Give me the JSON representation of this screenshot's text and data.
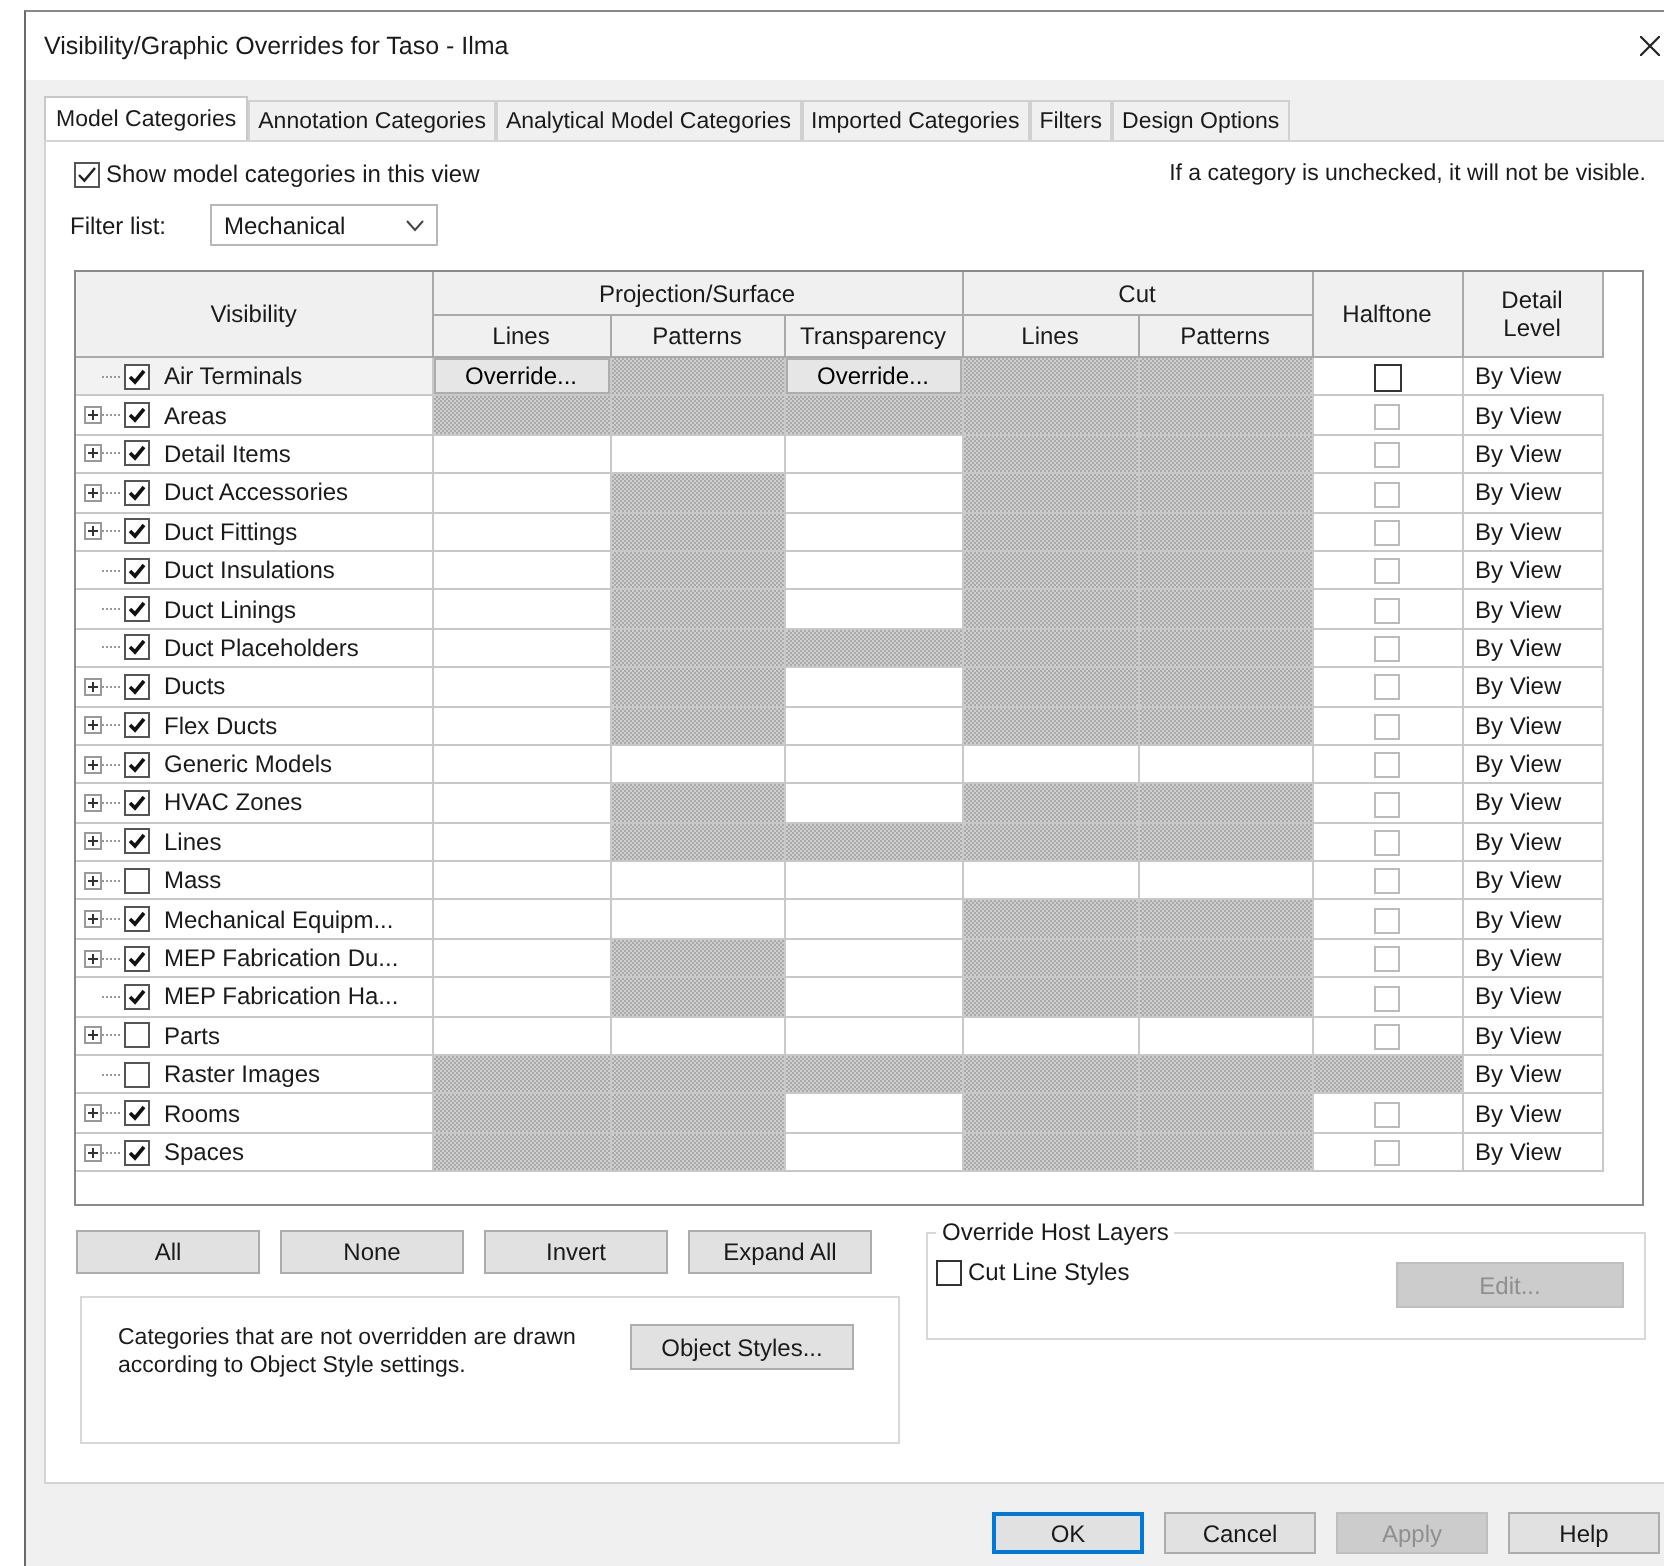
{
  "window": {
    "title": "Visibility/Graphic Overrides for Taso - Ilma"
  },
  "tabs": [
    {
      "label": "Model Categories",
      "selected": true
    },
    {
      "label": "Annotation Categories",
      "selected": false
    },
    {
      "label": "Analytical Model Categories",
      "selected": false
    },
    {
      "label": "Imported Categories",
      "selected": false
    },
    {
      "label": "Filters",
      "selected": false
    },
    {
      "label": "Design Options",
      "selected": false
    }
  ],
  "show_checkbox": {
    "label": "Show model categories in this view",
    "checked": true
  },
  "hint": "If a category is unchecked, it will not be visible.",
  "filter": {
    "label": "Filter list:",
    "value": "Mechanical"
  },
  "table": {
    "visibility": "Visibility",
    "groups": [
      {
        "label": "Projection/Surface",
        "columns": [
          "Lines",
          "Patterns",
          "Transparency"
        ]
      },
      {
        "label": "Cut",
        "columns": [
          "Lines",
          "Patterns"
        ]
      }
    ],
    "halftone": "Halftone",
    "detail_level": "Detail Level",
    "rows": [
      {
        "name": "Air Terminals",
        "checked": true,
        "expandable": false,
        "selected": true,
        "cells": [
          {
            "kind": "button",
            "label": "Override..."
          },
          {
            "kind": "hatched"
          },
          {
            "kind": "button",
            "label": "Override..."
          },
          {
            "kind": "hatched"
          },
          {
            "kind": "hatched"
          }
        ],
        "halftone": {
          "kind": "checkbox",
          "checked": false
        },
        "detail": "By View"
      },
      {
        "name": "Areas",
        "checked": true,
        "expandable": true,
        "selected": false,
        "cells": [
          {
            "kind": "hatched"
          },
          {
            "kind": "hatched"
          },
          {
            "kind": "hatched"
          },
          {
            "kind": "hatched"
          },
          {
            "kind": "hatched"
          }
        ],
        "halftone": {
          "kind": "checkbox",
          "checked": false
        },
        "detail": "By View"
      },
      {
        "name": "Detail Items",
        "checked": true,
        "expandable": true,
        "selected": false,
        "cells": [
          {
            "kind": "blank"
          },
          {
            "kind": "blank"
          },
          {
            "kind": "blank"
          },
          {
            "kind": "hatched"
          },
          {
            "kind": "hatched"
          }
        ],
        "halftone": {
          "kind": "checkbox",
          "checked": false
        },
        "detail": "By View"
      },
      {
        "name": "Duct Accessories",
        "checked": true,
        "expandable": true,
        "selected": false,
        "cells": [
          {
            "kind": "blank"
          },
          {
            "kind": "hatched"
          },
          {
            "kind": "blank"
          },
          {
            "kind": "hatched"
          },
          {
            "kind": "hatched"
          }
        ],
        "halftone": {
          "kind": "checkbox",
          "checked": false
        },
        "detail": "By View"
      },
      {
        "name": "Duct Fittings",
        "checked": true,
        "expandable": true,
        "selected": false,
        "cells": [
          {
            "kind": "blank"
          },
          {
            "kind": "hatched"
          },
          {
            "kind": "blank"
          },
          {
            "kind": "hatched"
          },
          {
            "kind": "hatched"
          }
        ],
        "halftone": {
          "kind": "checkbox",
          "checked": false
        },
        "detail": "By View"
      },
      {
        "name": "Duct Insulations",
        "checked": true,
        "expandable": false,
        "selected": false,
        "cells": [
          {
            "kind": "blank"
          },
          {
            "kind": "hatched"
          },
          {
            "kind": "blank"
          },
          {
            "kind": "hatched"
          },
          {
            "kind": "hatched"
          }
        ],
        "halftone": {
          "kind": "checkbox",
          "checked": false
        },
        "detail": "By View"
      },
      {
        "name": "Duct Linings",
        "checked": true,
        "expandable": false,
        "selected": false,
        "cells": [
          {
            "kind": "blank"
          },
          {
            "kind": "hatched"
          },
          {
            "kind": "blank"
          },
          {
            "kind": "hatched"
          },
          {
            "kind": "hatched"
          }
        ],
        "halftone": {
          "kind": "checkbox",
          "checked": false
        },
        "detail": "By View"
      },
      {
        "name": "Duct Placeholders",
        "checked": true,
        "expandable": false,
        "selected": false,
        "cells": [
          {
            "kind": "blank"
          },
          {
            "kind": "hatched"
          },
          {
            "kind": "hatched"
          },
          {
            "kind": "hatched"
          },
          {
            "kind": "hatched"
          }
        ],
        "halftone": {
          "kind": "checkbox",
          "checked": false
        },
        "detail": "By View"
      },
      {
        "name": "Ducts",
        "checked": true,
        "expandable": true,
        "selected": false,
        "cells": [
          {
            "kind": "blank"
          },
          {
            "kind": "hatched"
          },
          {
            "kind": "blank"
          },
          {
            "kind": "hatched"
          },
          {
            "kind": "hatched"
          }
        ],
        "halftone": {
          "kind": "checkbox",
          "checked": false
        },
        "detail": "By View"
      },
      {
        "name": "Flex Ducts",
        "checked": true,
        "expandable": true,
        "selected": false,
        "cells": [
          {
            "kind": "blank"
          },
          {
            "kind": "hatched"
          },
          {
            "kind": "blank"
          },
          {
            "kind": "hatched"
          },
          {
            "kind": "hatched"
          }
        ],
        "halftone": {
          "kind": "checkbox",
          "checked": false
        },
        "detail": "By View"
      },
      {
        "name": "Generic Models",
        "checked": true,
        "expandable": true,
        "selected": false,
        "cells": [
          {
            "kind": "blank"
          },
          {
            "kind": "blank"
          },
          {
            "kind": "blank"
          },
          {
            "kind": "blank"
          },
          {
            "kind": "blank"
          }
        ],
        "halftone": {
          "kind": "checkbox",
          "checked": false
        },
        "detail": "By View"
      },
      {
        "name": "HVAC Zones",
        "checked": true,
        "expandable": true,
        "selected": false,
        "cells": [
          {
            "kind": "blank"
          },
          {
            "kind": "hatched"
          },
          {
            "kind": "blank"
          },
          {
            "kind": "hatched"
          },
          {
            "kind": "hatched"
          }
        ],
        "halftone": {
          "kind": "checkbox",
          "checked": false
        },
        "detail": "By View"
      },
      {
        "name": "Lines",
        "checked": true,
        "expandable": true,
        "selected": false,
        "cells": [
          {
            "kind": "blank"
          },
          {
            "kind": "hatched"
          },
          {
            "kind": "hatched"
          },
          {
            "kind": "hatched"
          },
          {
            "kind": "hatched"
          }
        ],
        "halftone": {
          "kind": "checkbox",
          "checked": false
        },
        "detail": "By View"
      },
      {
        "name": "Mass",
        "checked": false,
        "expandable": true,
        "selected": false,
        "cells": [
          {
            "kind": "blank"
          },
          {
            "kind": "blank"
          },
          {
            "kind": "blank"
          },
          {
            "kind": "blank"
          },
          {
            "kind": "blank"
          }
        ],
        "halftone": {
          "kind": "checkbox",
          "checked": false
        },
        "detail": "By View"
      },
      {
        "name": "Mechanical Equipm...",
        "checked": true,
        "expandable": true,
        "selected": false,
        "cells": [
          {
            "kind": "blank"
          },
          {
            "kind": "blank"
          },
          {
            "kind": "blank"
          },
          {
            "kind": "hatched"
          },
          {
            "kind": "hatched"
          }
        ],
        "halftone": {
          "kind": "checkbox",
          "checked": false
        },
        "detail": "By View"
      },
      {
        "name": "MEP Fabrication Du...",
        "checked": true,
        "expandable": true,
        "selected": false,
        "cells": [
          {
            "kind": "blank"
          },
          {
            "kind": "hatched"
          },
          {
            "kind": "blank"
          },
          {
            "kind": "hatched"
          },
          {
            "kind": "hatched"
          }
        ],
        "halftone": {
          "kind": "checkbox",
          "checked": false
        },
        "detail": "By View"
      },
      {
        "name": "MEP Fabrication Ha...",
        "checked": true,
        "expandable": false,
        "selected": false,
        "cells": [
          {
            "kind": "blank"
          },
          {
            "kind": "hatched"
          },
          {
            "kind": "blank"
          },
          {
            "kind": "hatched"
          },
          {
            "kind": "hatched"
          }
        ],
        "halftone": {
          "kind": "checkbox",
          "checked": false
        },
        "detail": "By View"
      },
      {
        "name": "Parts",
        "checked": false,
        "expandable": true,
        "selected": false,
        "cells": [
          {
            "kind": "blank"
          },
          {
            "kind": "blank"
          },
          {
            "kind": "blank"
          },
          {
            "kind": "blank"
          },
          {
            "kind": "blank"
          }
        ],
        "halftone": {
          "kind": "checkbox",
          "checked": false
        },
        "detail": "By View"
      },
      {
        "name": "Raster Images",
        "checked": false,
        "expandable": false,
        "selected": false,
        "cells": [
          {
            "kind": "hatched"
          },
          {
            "kind": "hatched"
          },
          {
            "kind": "hatched"
          },
          {
            "kind": "hatched"
          },
          {
            "kind": "hatched"
          }
        ],
        "halftone": {
          "kind": "hatched"
        },
        "detail": "By View"
      },
      {
        "name": "Rooms",
        "checked": true,
        "expandable": true,
        "selected": false,
        "cells": [
          {
            "kind": "hatched"
          },
          {
            "kind": "hatched"
          },
          {
            "kind": "blank"
          },
          {
            "kind": "hatched"
          },
          {
            "kind": "hatched"
          }
        ],
        "halftone": {
          "kind": "checkbox",
          "checked": false
        },
        "detail": "By View"
      },
      {
        "name": "Spaces",
        "checked": true,
        "expandable": true,
        "selected": false,
        "cells": [
          {
            "kind": "hatched"
          },
          {
            "kind": "hatched"
          },
          {
            "kind": "blank"
          },
          {
            "kind": "hatched"
          },
          {
            "kind": "hatched"
          }
        ],
        "halftone": {
          "kind": "checkbox",
          "checked": false
        },
        "detail": "By View"
      }
    ]
  },
  "selection_buttons": [
    "All",
    "None",
    "Invert",
    "Expand All"
  ],
  "override_host_layers": {
    "title": "Override Host Layers",
    "checkbox": {
      "label": "Cut Line Styles",
      "checked": false
    },
    "button": {
      "label": "Edit...",
      "disabled": true
    }
  },
  "info": {
    "text": "Categories that are not overridden are drawn according to Object Style settings.",
    "button": "Object Styles..."
  },
  "footer_buttons": [
    {
      "label": "OK",
      "disabled": false,
      "default": true
    },
    {
      "label": "Cancel",
      "disabled": false,
      "default": false
    },
    {
      "label": "Apply",
      "disabled": true,
      "default": false
    },
    {
      "label": "Help",
      "disabled": false,
      "default": false
    }
  ]
}
